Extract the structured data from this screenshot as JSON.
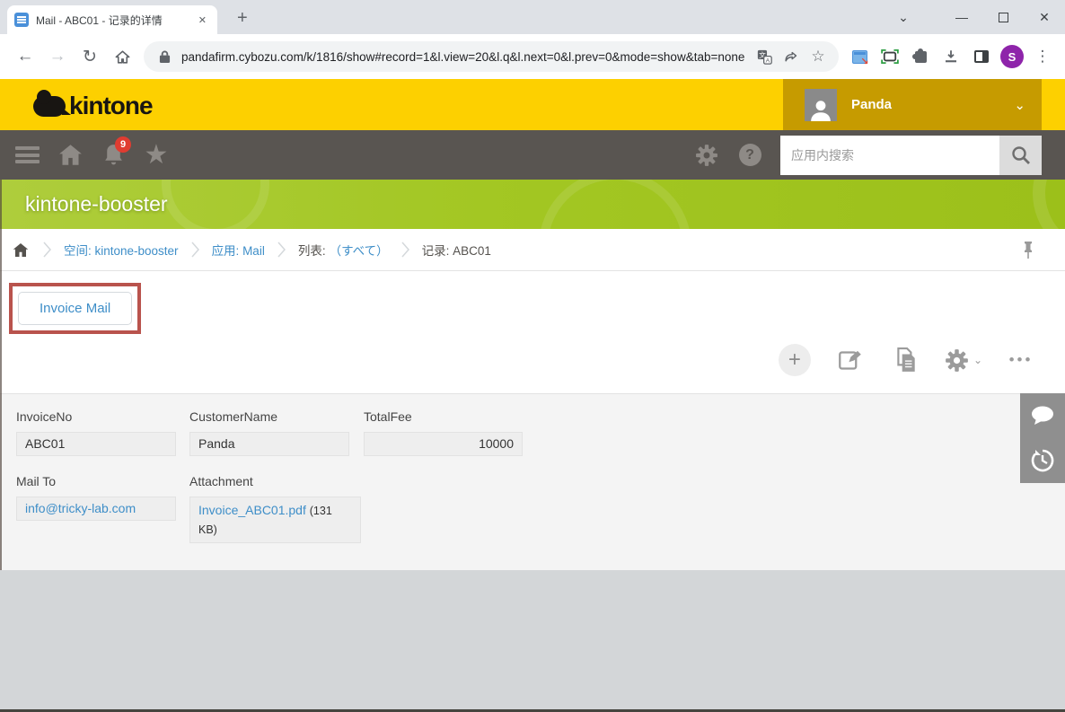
{
  "colors": {
    "kintone_yellow": "#fdd000",
    "user_block_gold": "#c69b00",
    "nav_dark": "#595551",
    "banner_green": "#9cc01a",
    "link_blue": "#3e8ec8",
    "highlight_red": "#b9534d",
    "badge_red": "#e03c31",
    "profile_purple": "#8e24aa"
  },
  "browser": {
    "tab_title": "Mail - ABC01 - 记录的详情",
    "url": "pandafirm.cybozu.com/k/1816/show#record=1&l.view=20&l.q&l.next=0&l.prev=0&mode=show&tab=none",
    "profile_initial": "S"
  },
  "icons": {
    "tab_close": "✕",
    "new_tab": "+",
    "tab_search_chevron": "⌄",
    "minimize": "—",
    "window_close": "✕",
    "back": "←",
    "forward": "→",
    "reload": "↻",
    "bookmark_star": "☆",
    "more_vertical": "⋮",
    "plus": "+",
    "ellipsis": "•••",
    "chevron_down": "⌄",
    "help": "?",
    "nav_star": "★"
  },
  "header": {
    "logo_text": "kintone",
    "user_name": "Panda"
  },
  "nav": {
    "notification_count": "9",
    "search_placeholder": "应用内搜索"
  },
  "banner": {
    "title": "kintone-booster"
  },
  "breadcrumb": {
    "space": "空间: kintone-booster",
    "app": "应用: Mail",
    "list_prefix": "列表:",
    "list_value": "（すべて）",
    "record": "记录: ABC01"
  },
  "content": {
    "action_button": "Invoice Mail"
  },
  "record": {
    "fields": {
      "invoice_no": {
        "label": "InvoiceNo",
        "value": "ABC01"
      },
      "customer_name": {
        "label": "CustomerName",
        "value": "Panda"
      },
      "total_fee": {
        "label": "TotalFee",
        "value": "10000"
      },
      "mail_to": {
        "label": "Mail To",
        "value": "info@tricky-lab.com"
      },
      "attachment": {
        "label": "Attachment",
        "file_name": "Invoice_ABC01.pdf",
        "file_size": "(131 KB)"
      }
    }
  }
}
